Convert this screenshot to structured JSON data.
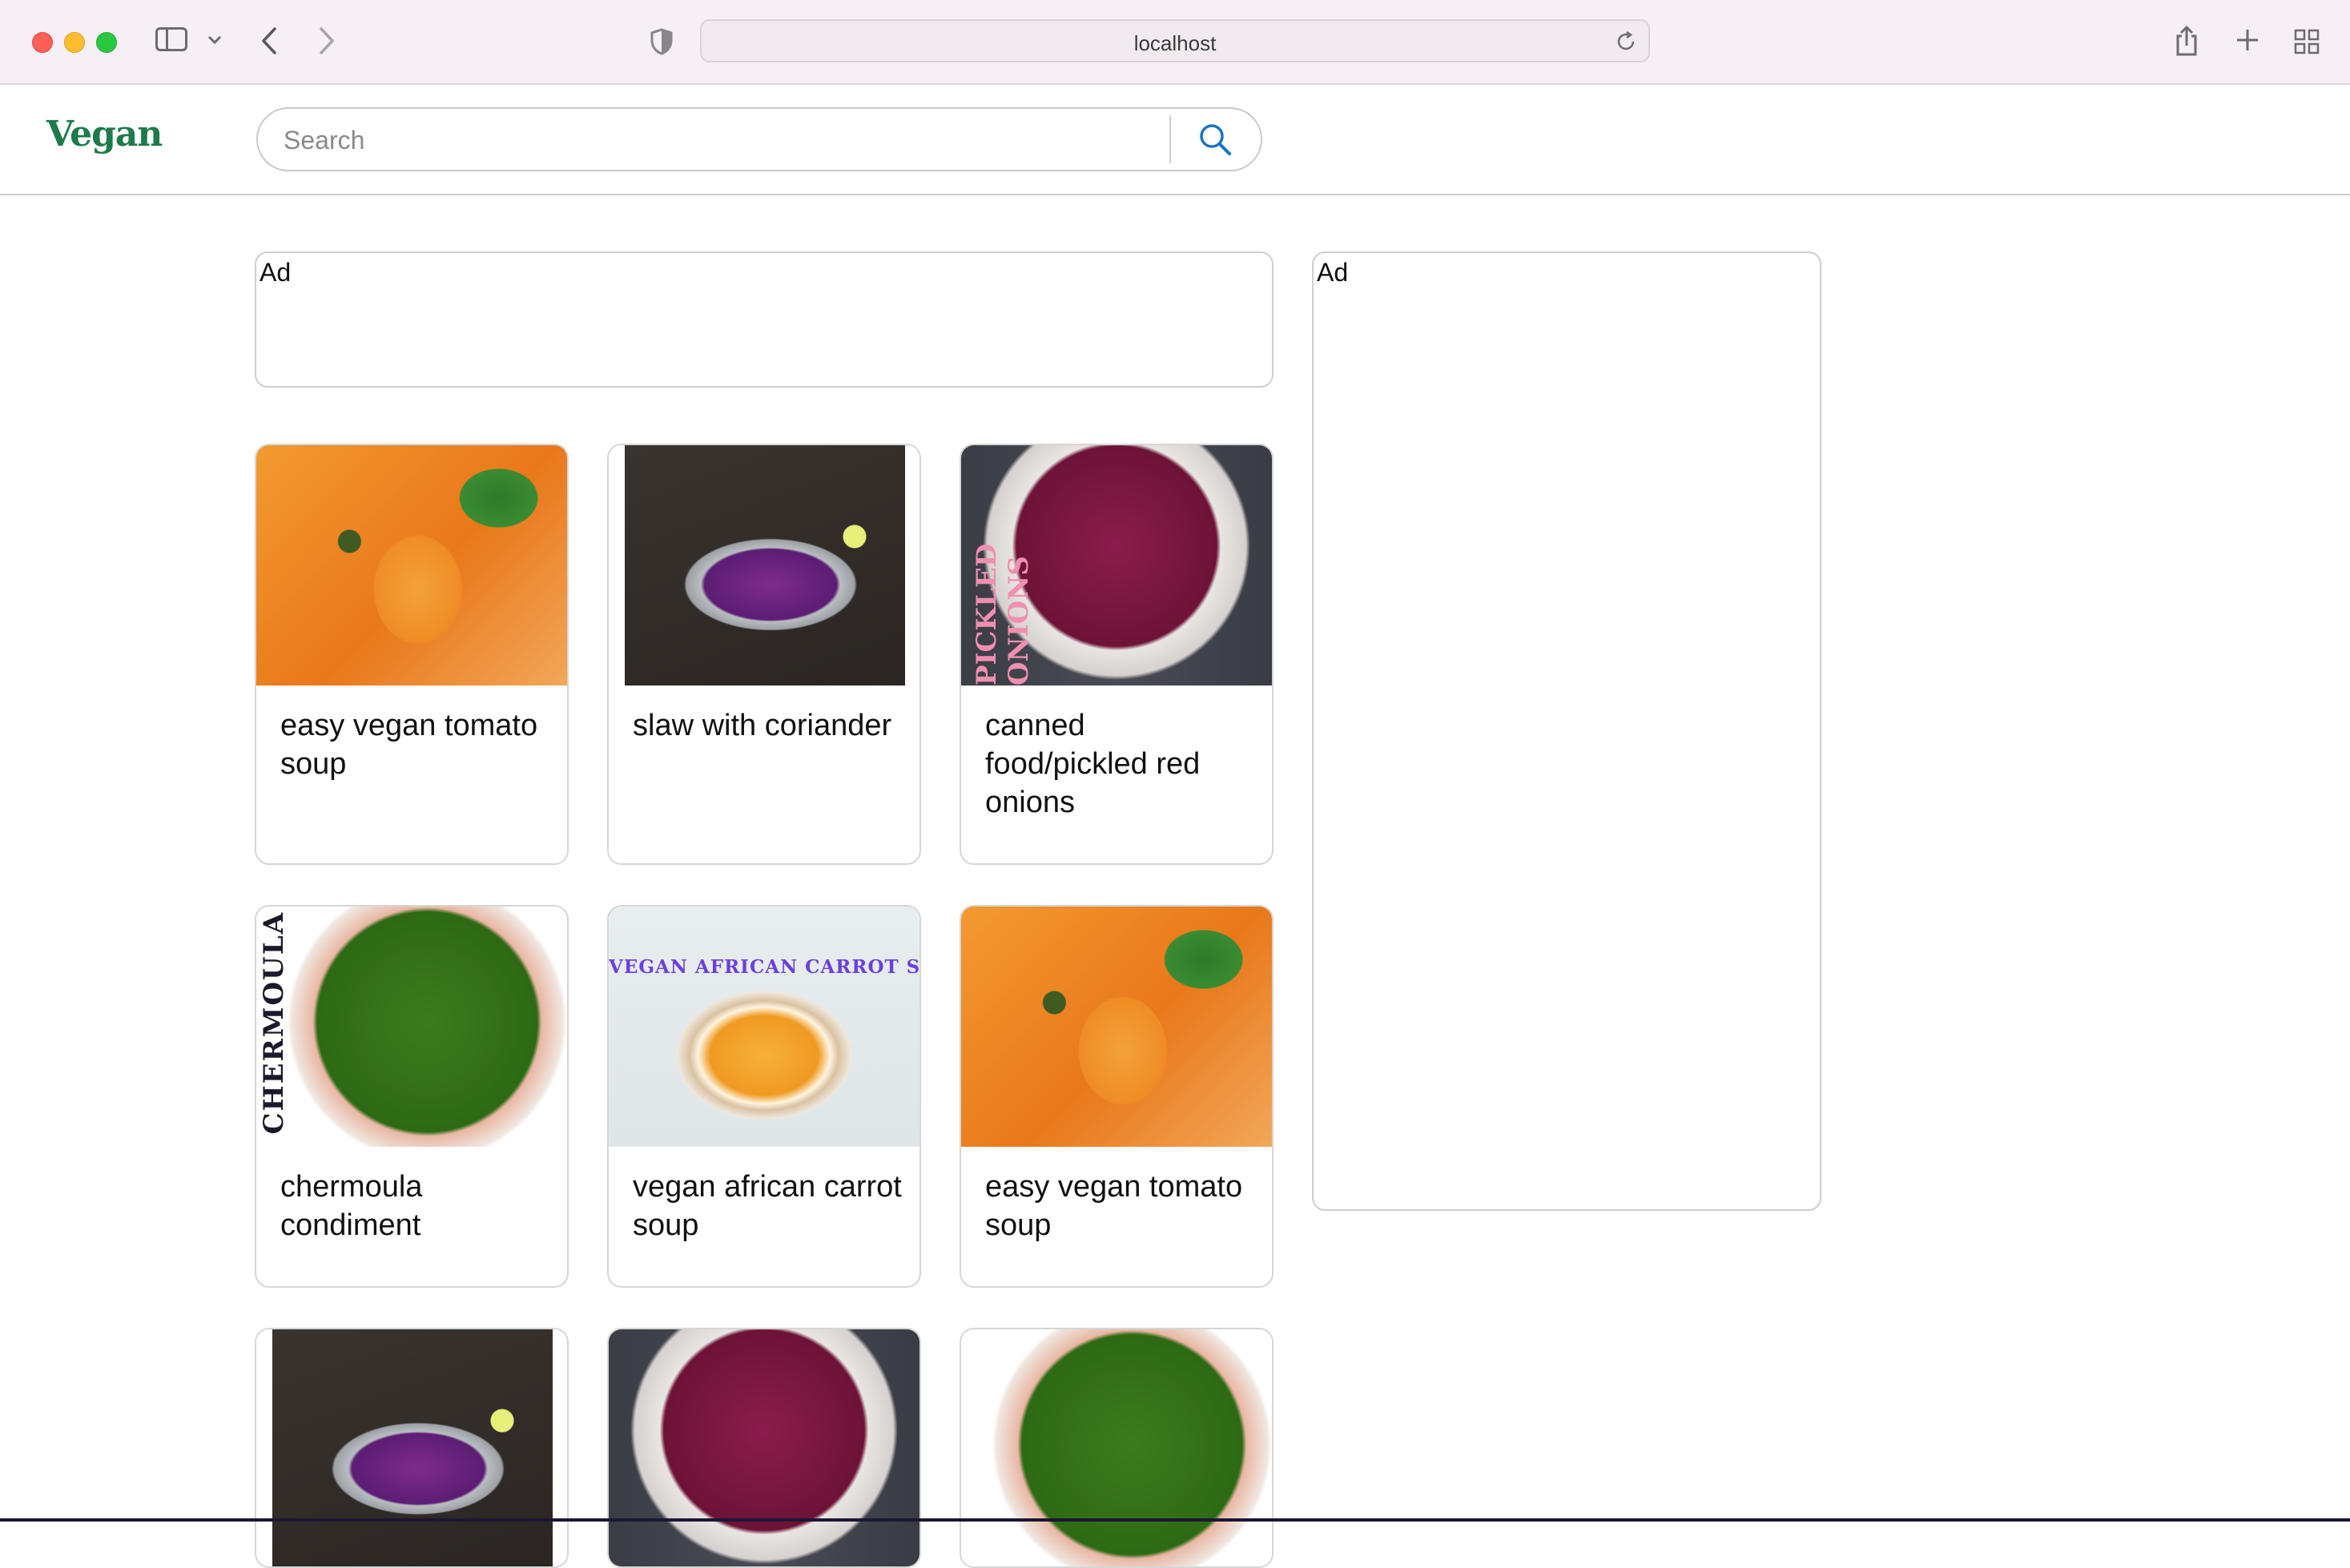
{
  "browser": {
    "url": "localhost"
  },
  "site": {
    "logo": "Vegan",
    "search": {
      "placeholder": "Search"
    }
  },
  "ads": {
    "top_label": "Ad",
    "side_label": "Ad"
  },
  "recipes": [
    {
      "title": "easy vegan tomato soup",
      "image": "tomato-soup"
    },
    {
      "title": "slaw with coriander",
      "image": "red-cabbage-slaw"
    },
    {
      "title": "canned food/pickled red onions",
      "image": "pickled-red-onions"
    },
    {
      "title": "chermoula condiment",
      "image": "chermoula"
    },
    {
      "title": "vegan african carrot soup",
      "image": "carrot-soup"
    },
    {
      "title": "easy vegan tomato soup",
      "image": "tomato-soup"
    },
    {
      "title": "",
      "image": "red-cabbage-slaw"
    },
    {
      "title": "",
      "image": "pickled-red-onions"
    },
    {
      "title": "",
      "image": "chermoula"
    }
  ],
  "image_overlays": {
    "chermoula": "CHERMOULA",
    "carrot": "VEGAN AFRICAN CARROT SOUP",
    "pickled": "PICKLED ONIONS"
  },
  "colors": {
    "logo": "#1e7a4a",
    "search_icon": "#1a73c9",
    "titlebar": "#f6eff5"
  }
}
